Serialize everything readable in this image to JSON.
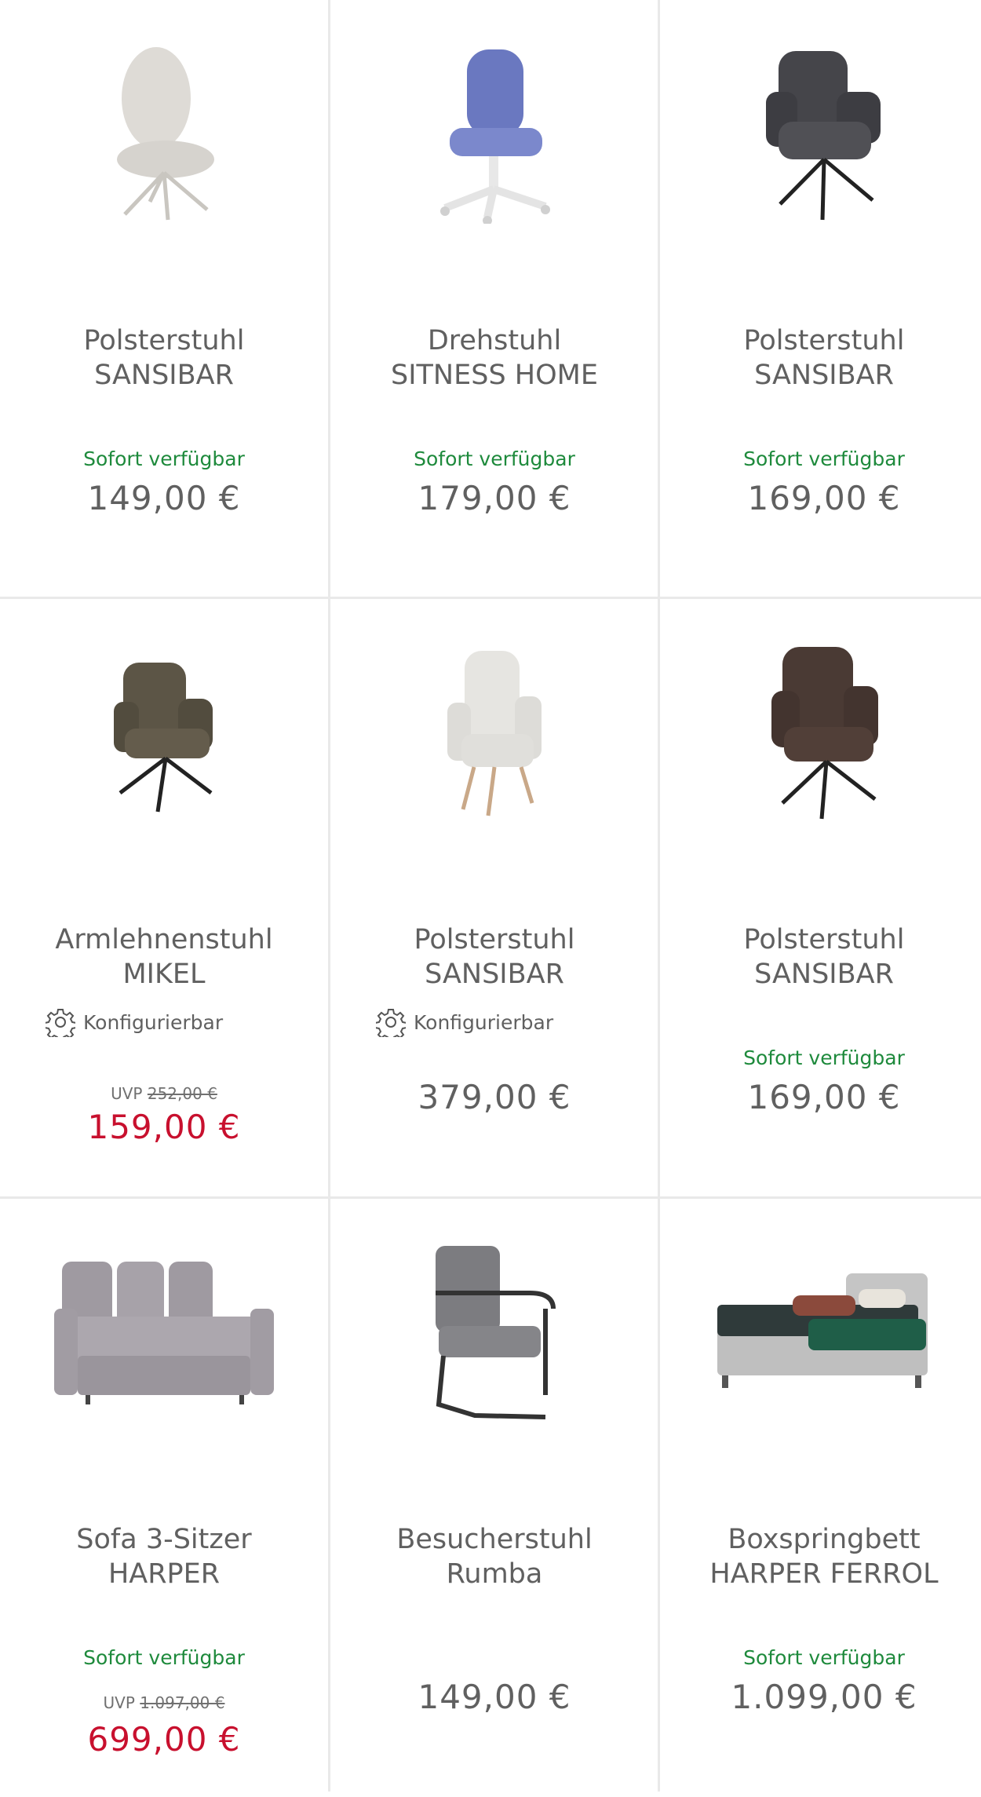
{
  "products": [
    {
      "title1": "Polsterstuhl",
      "title2": "SANSIBAR",
      "availability": "Sofort verfügbar",
      "price": "149,00 €",
      "icon": "chair-light-grey-image"
    },
    {
      "title1": "Drehstuhl",
      "title2": "SITNESS HOME",
      "availability": "Sofort verfügbar",
      "price": "179,00 €",
      "icon": "office-chair-blue-image"
    },
    {
      "title1": "Polsterstuhl",
      "title2": "SANSIBAR",
      "availability": "Sofort verfügbar",
      "price": "169,00 €",
      "icon": "chair-dark-grey-image"
    },
    {
      "title1": "Armlehnenstuhl",
      "title2": "MIKEL",
      "config": "Konfigurierbar",
      "uvp_label": "UVP",
      "uvp_price": "252,00 €",
      "price": "159,00 €",
      "icon": "armchair-olive-image"
    },
    {
      "title1": "Polsterstuhl",
      "title2": "SANSIBAR",
      "config": "Konfigurierbar",
      "price": "379,00 €",
      "icon": "armchair-white-image"
    },
    {
      "title1": "Polsterstuhl",
      "title2": "SANSIBAR",
      "availability": "Sofort verfügbar",
      "price": "169,00 €",
      "icon": "armchair-brown-image"
    },
    {
      "title1": "Sofa 3-Sitzer",
      "title2": "HARPER",
      "availability": "Sofort verfügbar",
      "uvp_label": "UVP",
      "uvp_price": "1.097,00 €",
      "price": "699,00 €",
      "icon": "sofa-grey-image"
    },
    {
      "title1": "Besucherstuhl",
      "title2": "Rumba",
      "price": "149,00 €",
      "icon": "cantilever-chair-grey-image"
    },
    {
      "title1": "Boxspringbett",
      "title2": "HARPER FERROL",
      "availability": "Sofort verfügbar",
      "price": "1.099,00 €",
      "icon": "boxspring-bed-image"
    }
  ],
  "colors": {
    "available": "#1e8a3c",
    "sale": "#c8102e",
    "text": "#606060",
    "divider": "#e9e9e9"
  }
}
